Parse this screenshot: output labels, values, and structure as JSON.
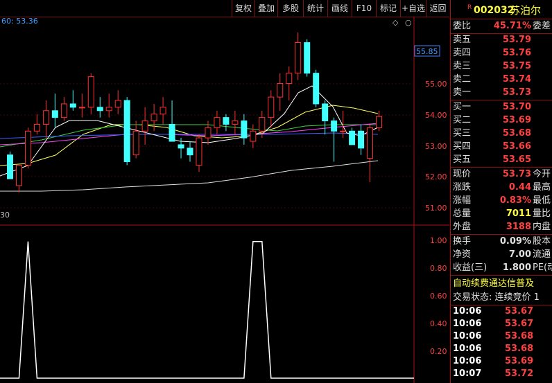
{
  "toolbar": {
    "buttons": [
      "复权",
      "叠加",
      "多股",
      "统计",
      "画线",
      "F10",
      "标记",
      "+自选",
      "返回"
    ]
  },
  "stock": {
    "tag": "R",
    "code": "002032",
    "name": "苏泊尔"
  },
  "chart": {
    "ma_legend": "60: 53.36",
    "price_axis": [
      "55.00",
      "54.00",
      "53.00",
      "52.00",
      "51.00"
    ],
    "current_price_tag": "55.85",
    "left_label": "30",
    "indicator_axis": [
      "1.00",
      "0.80",
      "0.60",
      "0.40",
      "0.20"
    ]
  },
  "chart_data": {
    "type": "candlestick",
    "y_range": [
      50.6,
      56.5
    ],
    "candles": [
      {
        "o": 52.6,
        "h": 52.7,
        "l": 51.9,
        "c": 51.9
      },
      {
        "o": 51.7,
        "h": 52.3,
        "l": 51.5,
        "c": 52.3
      },
      {
        "o": 52.3,
        "h": 53.4,
        "l": 52.2,
        "c": 53.3
      },
      {
        "o": 53.3,
        "h": 53.8,
        "l": 53.2,
        "c": 53.5
      },
      {
        "o": 53.5,
        "h": 54.2,
        "l": 53.1,
        "c": 53.9
      },
      {
        "o": 53.9,
        "h": 54.4,
        "l": 53.4,
        "c": 53.7
      },
      {
        "o": 53.7,
        "h": 54.3,
        "l": 53.6,
        "c": 54.1
      },
      {
        "o": 54.1,
        "h": 54.5,
        "l": 53.9,
        "c": 54.0
      },
      {
        "o": 54.0,
        "h": 54.4,
        "l": 53.7,
        "c": 54.0
      },
      {
        "o": 54.0,
        "h": 55.0,
        "l": 53.8,
        "c": 54.9
      },
      {
        "o": 54.0,
        "h": 54.3,
        "l": 53.7,
        "c": 53.9
      },
      {
        "o": 53.9,
        "h": 54.4,
        "l": 53.7,
        "c": 54.0
      },
      {
        "o": 54.0,
        "h": 54.5,
        "l": 53.8,
        "c": 54.2
      },
      {
        "o": 54.2,
        "h": 54.3,
        "l": 52.3,
        "c": 52.4
      },
      {
        "o": 52.6,
        "h": 53.6,
        "l": 52.5,
        "c": 53.3
      },
      {
        "o": 53.3,
        "h": 54.0,
        "l": 52.9,
        "c": 53.6
      },
      {
        "o": 53.6,
        "h": 54.1,
        "l": 53.3,
        "c": 53.8
      },
      {
        "o": 53.8,
        "h": 54.3,
        "l": 53.5,
        "c": 54.0
      },
      {
        "o": 53.5,
        "h": 54.2,
        "l": 53.0,
        "c": 53.0
      },
      {
        "o": 52.9,
        "h": 53.1,
        "l": 52.5,
        "c": 52.8
      },
      {
        "o": 52.8,
        "h": 53.0,
        "l": 52.4,
        "c": 52.6
      },
      {
        "o": 52.3,
        "h": 53.2,
        "l": 52.1,
        "c": 53.1
      },
      {
        "o": 53.1,
        "h": 53.6,
        "l": 52.9,
        "c": 53.4
      },
      {
        "o": 53.4,
        "h": 53.9,
        "l": 53.2,
        "c": 53.7
      },
      {
        "o": 53.7,
        "h": 53.8,
        "l": 53.3,
        "c": 53.5
      },
      {
        "o": 53.5,
        "h": 53.9,
        "l": 53.2,
        "c": 53.6
      },
      {
        "o": 53.6,
        "h": 53.8,
        "l": 52.9,
        "c": 53.1
      },
      {
        "o": 53.0,
        "h": 53.5,
        "l": 52.8,
        "c": 53.3
      },
      {
        "o": 53.3,
        "h": 53.9,
        "l": 53.1,
        "c": 53.7
      },
      {
        "o": 53.7,
        "h": 54.5,
        "l": 53.4,
        "c": 54.3
      },
      {
        "o": 54.3,
        "h": 55.0,
        "l": 53.9,
        "c": 54.7
      },
      {
        "o": 54.7,
        "h": 55.2,
        "l": 54.2,
        "c": 55.0
      },
      {
        "o": 55.0,
        "h": 56.2,
        "l": 54.8,
        "c": 55.9
      },
      {
        "o": 55.9,
        "h": 56.0,
        "l": 54.9,
        "c": 55.0
      },
      {
        "o": 55.0,
        "h": 55.1,
        "l": 54.0,
        "c": 54.1
      },
      {
        "o": 54.1,
        "h": 54.2,
        "l": 53.2,
        "c": 53.6
      },
      {
        "o": 53.6,
        "h": 53.7,
        "l": 52.4,
        "c": 53.3
      },
      {
        "o": 53.3,
        "h": 53.9,
        "l": 53.1,
        "c": 53.3
      },
      {
        "o": 53.3,
        "h": 53.4,
        "l": 52.9,
        "c": 52.9
      },
      {
        "o": 53.3,
        "h": 53.5,
        "l": 52.6,
        "c": 52.8
      },
      {
        "o": 52.5,
        "h": 53.5,
        "l": 51.8,
        "c": 53.4
      },
      {
        "o": 53.4,
        "h": 53.9,
        "l": 53.3,
        "c": 53.73
      }
    ],
    "indicator_values": [
      0,
      0,
      1,
      0,
      0,
      0,
      0,
      0,
      0,
      0,
      0,
      0,
      0,
      0,
      0,
      0,
      0,
      0,
      0,
      0,
      0,
      0,
      0,
      0,
      0,
      0,
      0,
      1,
      1,
      0,
      0,
      0,
      0,
      0,
      0,
      0,
      0,
      0,
      0,
      0,
      0,
      0
    ],
    "indicator_range": [
      0,
      1.1
    ]
  },
  "quote": {
    "ratio_label": "委比",
    "ratio_value": "45.71%",
    "ratio_extra": "委差",
    "asks": [
      {
        "label": "卖五",
        "price": "53.79"
      },
      {
        "label": "卖四",
        "price": "53.76"
      },
      {
        "label": "卖三",
        "price": "53.75"
      },
      {
        "label": "卖二",
        "price": "53.74"
      },
      {
        "label": "卖一",
        "price": "53.73"
      }
    ],
    "bids": [
      {
        "label": "买一",
        "price": "53.70"
      },
      {
        "label": "买二",
        "price": "53.69"
      },
      {
        "label": "买三",
        "price": "53.68"
      },
      {
        "label": "买四",
        "price": "53.66"
      },
      {
        "label": "买五",
        "price": "53.65"
      }
    ],
    "stats": [
      {
        "label": "现价",
        "value": "53.73",
        "extra": "今开",
        "color": "#ff4040"
      },
      {
        "label": "涨跌",
        "value": "0.44",
        "extra": "最高",
        "color": "#ff4040"
      },
      {
        "label": "涨幅",
        "value": "0.83%",
        "extra": "最低",
        "color": "#ff4040"
      },
      {
        "label": "总量",
        "value": "7011",
        "extra": "量比",
        "color": "#ffff40"
      },
      {
        "label": "外盘",
        "value": "3188",
        "extra": "内盘",
        "color": "#ff4040"
      }
    ],
    "stats2": [
      {
        "label": "换手",
        "value": "0.09%",
        "extra": "股本"
      },
      {
        "label": "净资",
        "value": "7.00",
        "extra": "流通"
      },
      {
        "label": "收益(三)",
        "value": "1.800",
        "extra": "PE(动"
      }
    ],
    "ticker_text": "自动续费通达信普及",
    "trade_status": "交易状态: 连续竞价 1",
    "ticks": [
      {
        "time": "10:06",
        "price": "53.67"
      },
      {
        "time": "10:06",
        "price": "53.67"
      },
      {
        "time": "10:06",
        "price": "53.68"
      },
      {
        "time": "10:06",
        "price": "53.68"
      },
      {
        "time": "10:06",
        "price": "53.69"
      },
      {
        "time": "10:07",
        "price": "53.72"
      }
    ]
  }
}
